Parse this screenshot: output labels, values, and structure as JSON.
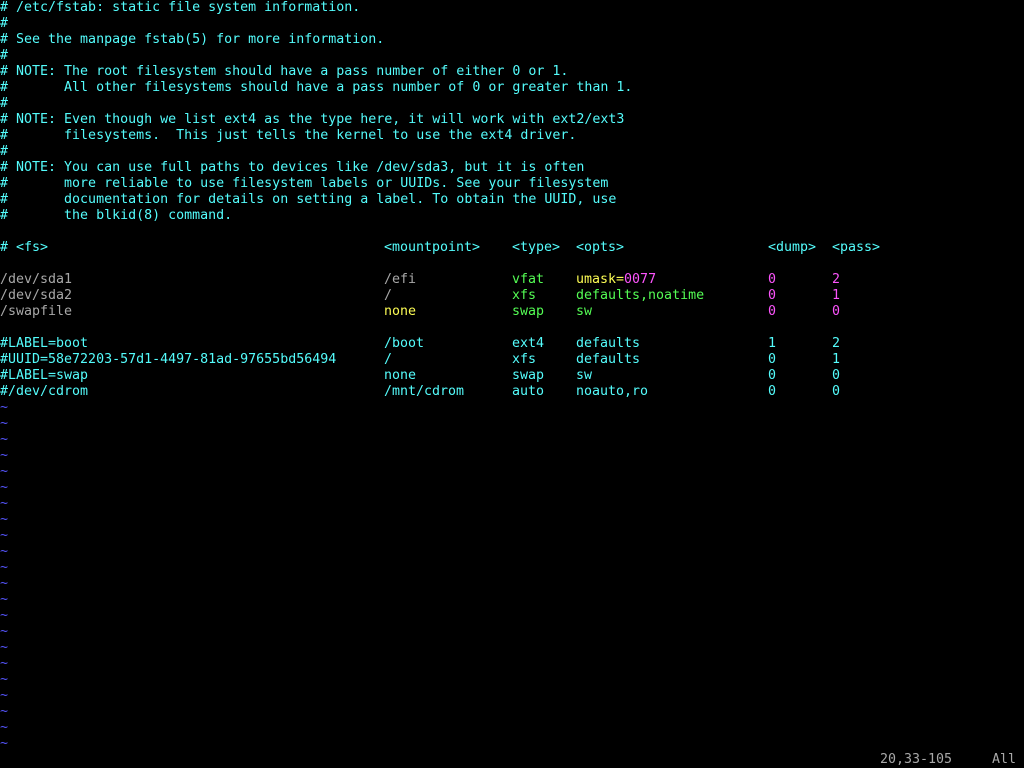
{
  "comments": [
    "# /etc/fstab: static file system information.",
    "#",
    "# See the manpage fstab(5) for more information.",
    "#",
    "# NOTE: The root filesystem should have a pass number of either 0 or 1.",
    "#       All other filesystems should have a pass number of 0 or greater than 1.",
    "#",
    "# NOTE: Even though we list ext4 as the type here, it will work with ext2/ext3",
    "#       filesystems.  This just tells the kernel to use the ext4 driver.",
    "#",
    "# NOTE: You can use full paths to devices like /dev/sda3, but it is often",
    "#       more reliable to use filesystem labels or UUIDs. See your filesystem",
    "#       documentation for details on setting a label. To obtain the UUID, use",
    "#       the blkid(8) command."
  ],
  "header": {
    "fs": "# <fs>",
    "mountpoint": "<mountpoint>",
    "type": "<type>",
    "opts": "<opts>",
    "dump": "<dump>",
    "pass": "<pass>"
  },
  "active_entries": [
    {
      "fs": "/dev/sda1",
      "mountpoint": "/efi",
      "type": "vfat",
      "opts_key": "umask=",
      "opts_val": "0077",
      "dump": "0",
      "pass": "2"
    },
    {
      "fs": "/dev/sda2",
      "mountpoint": "/",
      "type": "xfs",
      "opts_key": "defaults,noatime",
      "opts_val": "",
      "dump": "0",
      "pass": "1"
    },
    {
      "fs": "/swapfile",
      "mountpoint": "none",
      "type": "swap",
      "opts_key": "sw",
      "opts_val": "",
      "dump": "0",
      "pass": "0"
    }
  ],
  "commented_entries": [
    {
      "fs": "#LABEL=boot",
      "mountpoint": "/boot",
      "type": "ext4",
      "opts": "defaults",
      "dump": "1",
      "pass": "2"
    },
    {
      "fs": "#UUID=58e72203-57d1-4497-81ad-97655bd56494",
      "mountpoint": "/",
      "type": "xfs",
      "opts": "defaults",
      "dump": "0",
      "pass": "1"
    },
    {
      "fs": "#LABEL=swap",
      "mountpoint": "none",
      "type": "swap",
      "opts": "sw",
      "dump": "0",
      "pass": "0"
    },
    {
      "fs": "#/dev/cdrom",
      "mountpoint": "/mnt/cdrom",
      "type": "auto",
      "opts": "noauto,ro",
      "dump": "0",
      "pass": "0"
    }
  ],
  "tilde": "~",
  "tilde_count": 22,
  "status": {
    "position": "20,33-105",
    "scroll": "All"
  },
  "colors": {
    "background": "#000000",
    "comment": "#54fcfc",
    "text": "#a8a8a8",
    "type": "#54fc54",
    "option": "#fcfc54",
    "number": "#fc54fc",
    "tilde": "#5454fc"
  }
}
